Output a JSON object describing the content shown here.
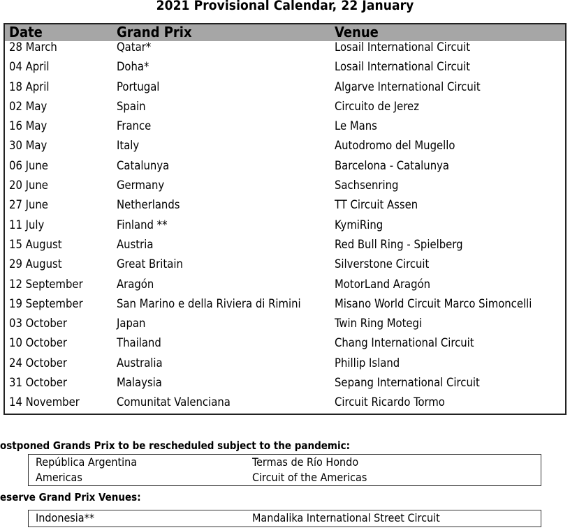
{
  "title": "2021 Provisional Calendar, 22 January",
  "calendar": {
    "headers": [
      "Date",
      "Grand Prix",
      "Venue"
    ],
    "rows": [
      [
        "28 March",
        "Qatar*",
        "Losail International Circuit"
      ],
      [
        "04 April",
        "Doha*",
        "Losail International Circuit"
      ],
      [
        "18 April",
        "Portugal",
        "Algarve International Circuit"
      ],
      [
        "02 May",
        "Spain",
        "Circuito de Jerez"
      ],
      [
        "16 May",
        "France",
        "Le Mans"
      ],
      [
        "30 May",
        "Italy",
        "Autodromo del Mugello"
      ],
      [
        "06 June",
        "Catalunya",
        "Barcelona - Catalunya"
      ],
      [
        "20 June",
        "Germany",
        "Sachsenring"
      ],
      [
        "27 June",
        "Netherlands",
        "TT Circuit Assen"
      ],
      [
        "11 July",
        "Finland **",
        "KymiRing"
      ],
      [
        "15 August",
        "Austria",
        "Red Bull Ring - Spielberg"
      ],
      [
        "29 August",
        "Great Britain",
        "Silverstone Circuit"
      ],
      [
        "12 September",
        "Aragón",
        "MotorLand Aragón"
      ],
      [
        "19 September",
        "San Marino e della Riviera di Rimini",
        "Misano World Circuit Marco Simoncelli"
      ],
      [
        "03 October",
        "Japan",
        "Twin Ring Motegi"
      ],
      [
        "10 October",
        "Thailand",
        "Chang International Circuit"
      ],
      [
        "24 October",
        "Australia",
        "Phillip Island"
      ],
      [
        "31 October",
        "Malaysia",
        "Sepang International Circuit"
      ],
      [
        "14 November",
        "Comunitat Valenciana",
        "Circuit Ricardo Tormo"
      ]
    ]
  },
  "postponed": {
    "heading": "ostponed Grands Prix to be rescheduled subject to the pandemic:",
    "rows": [
      [
        "República Argentina",
        "Termas de Río Hondo"
      ],
      [
        "Americas",
        "Circuit of the Americas"
      ]
    ]
  },
  "reserve": {
    "heading": "eserve Grand Prix Venues:",
    "rows": [
      [
        "Indonesia**",
        "Mandalika International Street Circuit"
      ]
    ]
  }
}
